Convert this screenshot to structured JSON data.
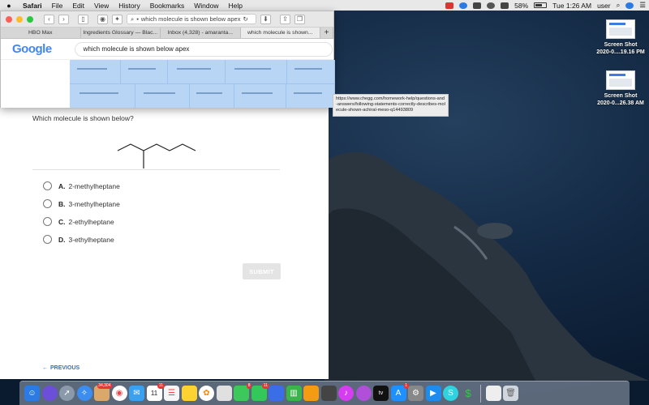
{
  "menubar": {
    "app": "Safari",
    "menus": [
      "File",
      "Edit",
      "View",
      "History",
      "Bookmarks",
      "Window",
      "Help"
    ],
    "battery": "58%",
    "clock": "Tue 1:26 AM",
    "user": "user"
  },
  "safari": {
    "address": "which molecule is shown below apex",
    "tabs": [
      "HBO Max",
      "Ingredients Glossary — Blac...",
      "Inbox (4,328) - amaranta...",
      "which molecule is shown..."
    ],
    "google_logo": "Google",
    "search_query": "which molecule is shown below apex",
    "tooltip_url": "https://www.chegg.com/homework-help/questions-and-answers/following-statements-correctly-describes-molecule-shown-achiral-meso-q14493809"
  },
  "desktop_icons": [
    {
      "title": "Screen Shot",
      "subtitle": "2020-0....19.16 PM"
    },
    {
      "title": "Screen Shot",
      "subtitle": "2020-0...26.38 AM"
    }
  ],
  "quiz": {
    "question": "Which molecule is shown below?",
    "choices": [
      {
        "letter": "A.",
        "text": "2-methylheptane"
      },
      {
        "letter": "B.",
        "text": "3-methylheptane"
      },
      {
        "letter": "C.",
        "text": "2-ethylheptane"
      },
      {
        "letter": "D.",
        "text": "3-ethylheptane"
      }
    ],
    "submit_label": "SUBMIT",
    "previous_label": "PREVIOUS"
  },
  "dock": {
    "badges": {
      "photos": "34,304",
      "calendar": "11",
      "mail": "8",
      "messages": "11",
      "appstore": "1"
    },
    "tv_label": "tv",
    "calendar_day": "11"
  }
}
